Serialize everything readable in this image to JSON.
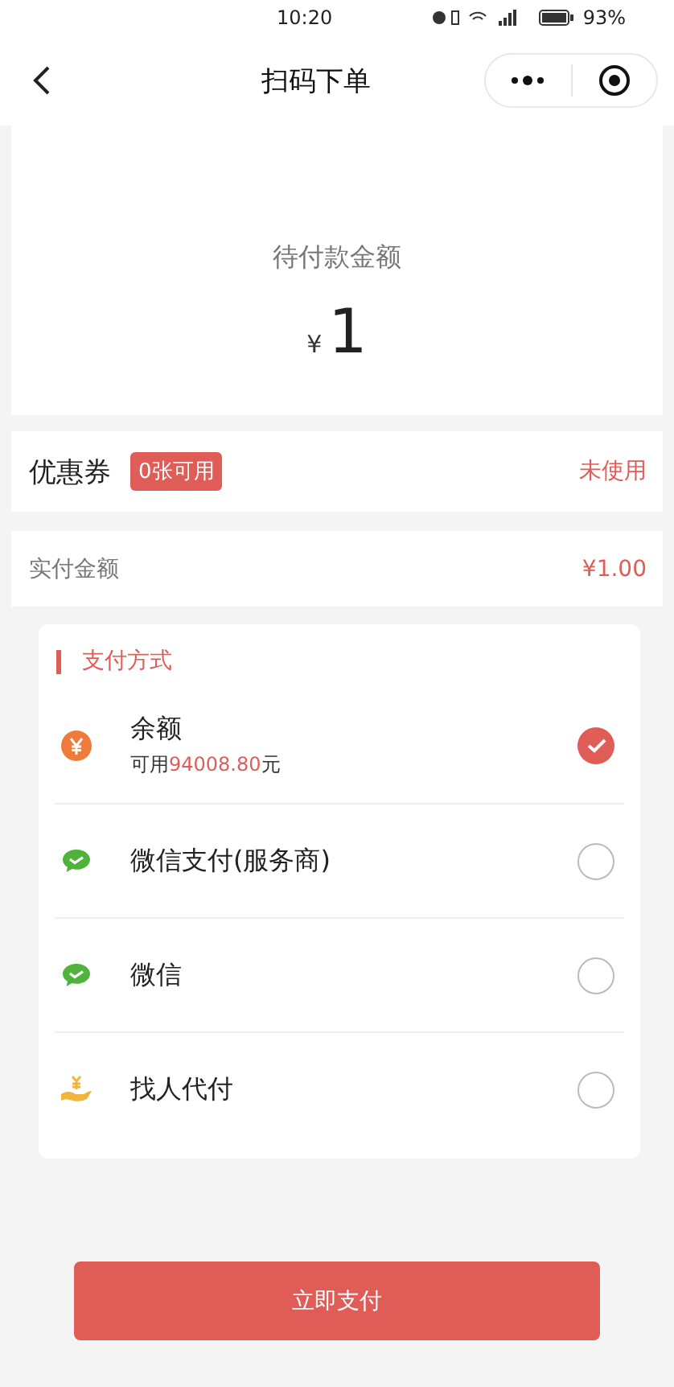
{
  "status_bar": {
    "time": "10:20",
    "battery": "93%"
  },
  "nav": {
    "title": "扫码下单"
  },
  "amount_due": {
    "label": "待付款金额",
    "currency": "¥",
    "value": "1"
  },
  "coupon": {
    "label": "优惠券",
    "badge": "0张可用",
    "status": "未使用"
  },
  "actual": {
    "label": "实付金额",
    "value": "¥1.00"
  },
  "payment": {
    "title": "支付方式",
    "methods": [
      {
        "kind": "balance",
        "label": "余额",
        "note": {
          "prefix": "可用",
          "amount": "94008.80",
          "suffix": "元"
        },
        "selected": true
      },
      {
        "kind": "wechat",
        "label": "微信支付(服务商)",
        "selected": false
      },
      {
        "kind": "wechat",
        "label": "微信",
        "selected": false
      },
      {
        "kind": "proxy",
        "label": "找人代付",
        "selected": false
      }
    ]
  },
  "pay_button": {
    "label": "立即支付"
  }
}
